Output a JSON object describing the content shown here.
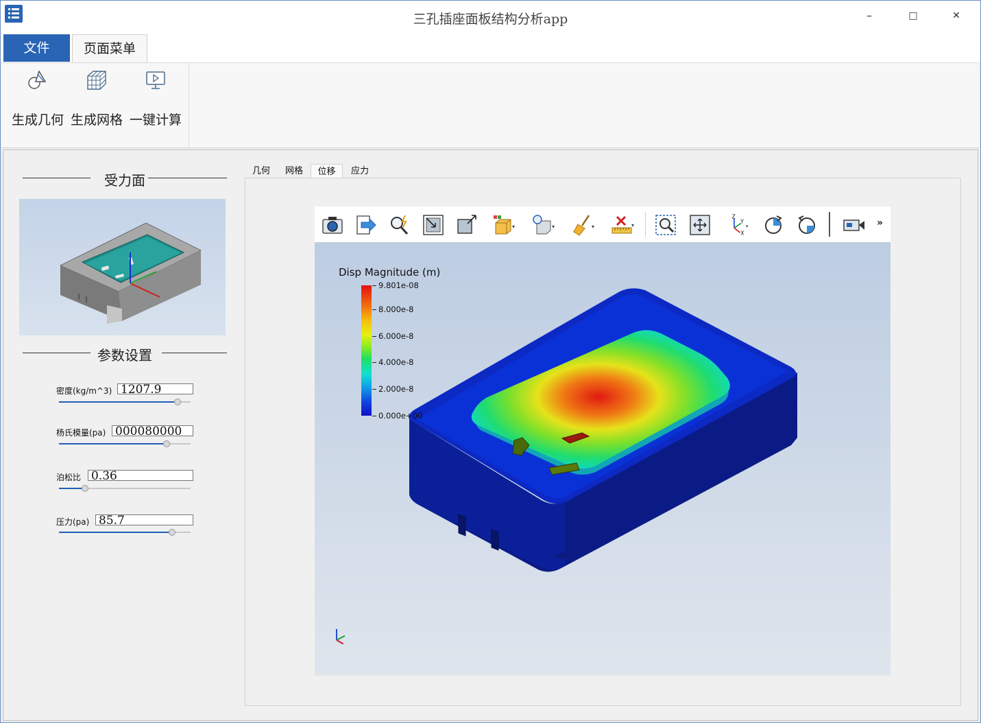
{
  "window": {
    "title": "三孔插座面板结构分析app",
    "minimize": "–",
    "maximize": "□",
    "close": "✕"
  },
  "ribbon": {
    "tabs": [
      {
        "label": "文件"
      },
      {
        "label": "页面菜单"
      }
    ],
    "buttons": [
      {
        "label": "生成几何",
        "icon": "geometry-icon"
      },
      {
        "label": "生成网格",
        "icon": "mesh-icon"
      },
      {
        "label": "一键计算",
        "icon": "compute-icon"
      }
    ]
  },
  "left_panel": {
    "force_section_title": "受力面",
    "params_section_title": "参数设置",
    "params": [
      {
        "label": "密度(kg/m^3)",
        "value": "1207.9",
        "slider_fraction": 0.9
      },
      {
        "label": "杨氏模量(pa)",
        "value": "000080000",
        "slider_fraction": 0.82
      },
      {
        "label": "泊松比",
        "value": "0.36",
        "slider_fraction": 0.2
      },
      {
        "label": "压力(pa)",
        "value": "85.7",
        "slider_fraction": 0.86
      }
    ]
  },
  "view_tabs": [
    {
      "label": "几何"
    },
    {
      "label": "网格"
    },
    {
      "label": "位移",
      "active": true
    },
    {
      "label": "应力"
    }
  ],
  "viewer": {
    "toolbar": [
      "camera-icon",
      "export-icon",
      "zoom-pick-icon",
      "reset-view-icon",
      "zoom-box-icon",
      "display-mode-icon",
      "light-icon",
      "clear-icon",
      "measure-icon",
      "zoom-window-icon",
      "fit-all-icon",
      "axes-icon",
      "rotate-cw-icon",
      "rotate-ccw-icon",
      "video-icon",
      "more-icon"
    ],
    "axes_labels": {
      "z": "Z",
      "y": "Y",
      "x": "X"
    },
    "overflow": "»",
    "legend": {
      "title": "Disp Magnitude (m)",
      "ticks": [
        "9.801e-08",
        "8.000e-8",
        "6.000e-8",
        "4.000e-8",
        "2.000e-8",
        "0.000e+00"
      ],
      "tick_values": [
        9.801e-08,
        8e-08,
        6e-08,
        4e-08,
        2e-08,
        0
      ],
      "max": 9.801e-08
    }
  },
  "colors": {
    "accent": "#2a64b4",
    "slider": "#1f5fb5"
  }
}
